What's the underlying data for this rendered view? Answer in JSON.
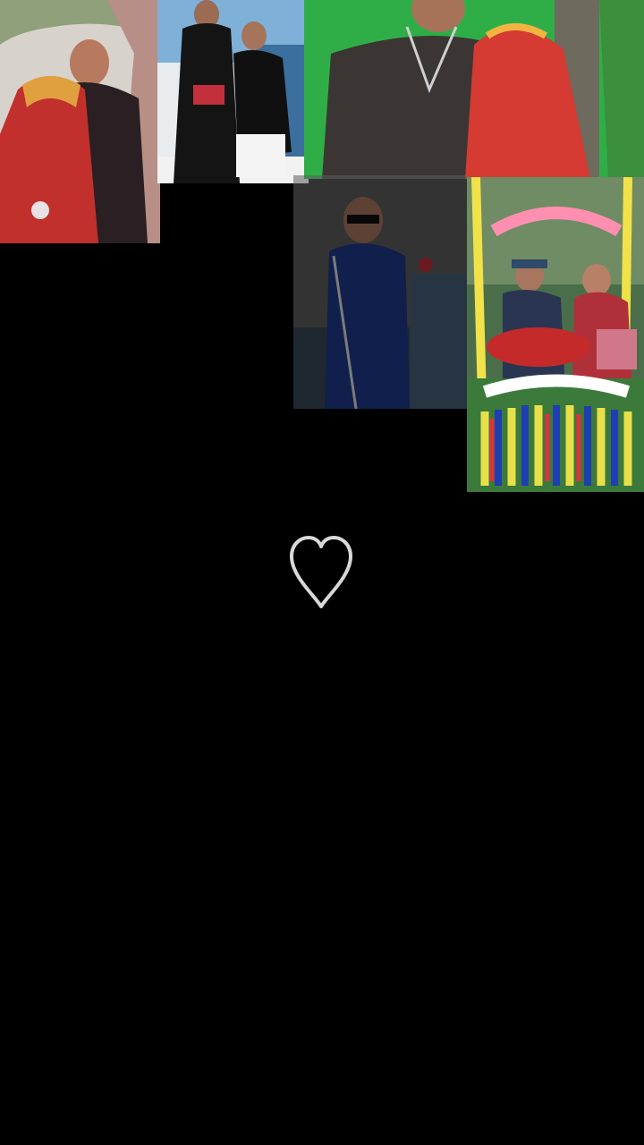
{
  "screen": {
    "background": "#000000"
  },
  "collage": {
    "photos": [
      {
        "subject": "couple-red-sari-tree",
        "palette": [
          "#d9d4cf",
          "#b9433f",
          "#2b1f1f"
        ]
      },
      {
        "subject": "couple-black-outfits-railing",
        "palette": [
          "#6a9bc8",
          "#111111",
          "#f1f1f1"
        ]
      },
      {
        "subject": "couple-green-background",
        "palette": [
          "#2fb34a",
          "#3a3533",
          "#d83a33"
        ]
      },
      {
        "subject": "woman-blue-sari-dimmed",
        "palette": [
          "#2b2b2b",
          "#1c2a5a",
          "#777777"
        ]
      },
      {
        "subject": "couple-flower-swing",
        "palette": [
          "#3a6a3a",
          "#e05050",
          "#ffffff"
        ]
      }
    ]
  },
  "like": {
    "icon": "heart-outline-icon",
    "color": "#d8d8d8"
  }
}
